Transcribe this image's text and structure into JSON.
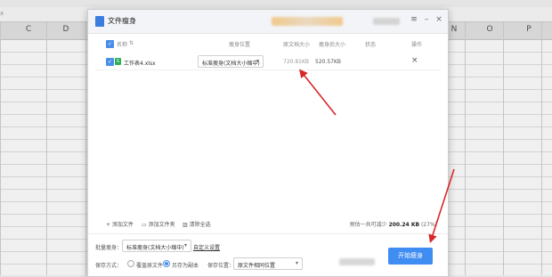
{
  "spreadsheet": {
    "namebox": "x",
    "columns": [
      "C",
      "D",
      "N",
      "O",
      "P"
    ]
  },
  "dialog": {
    "title": "文件瘦身",
    "window_buttons": {
      "menu": "≡",
      "minimize": "–",
      "close": "×"
    },
    "table": {
      "headers": {
        "name": "名称",
        "sort": "⇅",
        "slim_position": "瘦身位置",
        "original_size": "原文档大小",
        "slim_size": "瘦身后大小",
        "status": "状态",
        "action": "操作"
      },
      "rows": [
        {
          "checked": true,
          "file_icon": "S",
          "file_name": "工作表4.xlsx",
          "slim_option": "标准瘦身(文档大小缩中)",
          "original_size": "720.81KB",
          "slim_size": "520.57KB",
          "status": "",
          "delete_icon": "×"
        }
      ]
    },
    "actions": {
      "add_file": "+ 添加文件",
      "add_folder": "添加文件夹",
      "clear_all": "清除全选",
      "summary_prefix": "预估一共可减少",
      "summary_value": "200.24 KB",
      "summary_suffix": "(27%)"
    },
    "batch": {
      "label": "批量瘦身：",
      "value": "标准瘦身(文档大小缩中)",
      "custom_link": "自定义设置"
    },
    "save": {
      "label": "保存方式：",
      "options": [
        "覆盖原文件",
        "另存为副本"
      ],
      "selected": "另存为副本",
      "location_label": "保存位置：",
      "location_value": "原文件相同位置"
    },
    "start_button": "开始瘦身"
  },
  "colors": {
    "accent": "#3f8cf3",
    "annotation_arrow": "#d9262a",
    "excel_green": "#2bae54"
  }
}
